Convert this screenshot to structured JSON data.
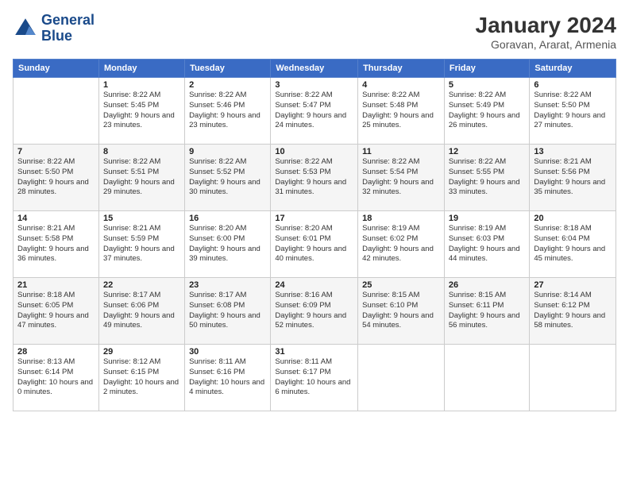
{
  "logo": {
    "line1": "General",
    "line2": "Blue"
  },
  "title": "January 2024",
  "subtitle": "Goravan, Ararat, Armenia",
  "weekdays": [
    "Sunday",
    "Monday",
    "Tuesday",
    "Wednesday",
    "Thursday",
    "Friday",
    "Saturday"
  ],
  "weeks": [
    [
      {
        "day": "",
        "sunrise": "",
        "sunset": "",
        "daylight": ""
      },
      {
        "day": "1",
        "sunrise": "Sunrise: 8:22 AM",
        "sunset": "Sunset: 5:45 PM",
        "daylight": "Daylight: 9 hours and 23 minutes."
      },
      {
        "day": "2",
        "sunrise": "Sunrise: 8:22 AM",
        "sunset": "Sunset: 5:46 PM",
        "daylight": "Daylight: 9 hours and 23 minutes."
      },
      {
        "day": "3",
        "sunrise": "Sunrise: 8:22 AM",
        "sunset": "Sunset: 5:47 PM",
        "daylight": "Daylight: 9 hours and 24 minutes."
      },
      {
        "day": "4",
        "sunrise": "Sunrise: 8:22 AM",
        "sunset": "Sunset: 5:48 PM",
        "daylight": "Daylight: 9 hours and 25 minutes."
      },
      {
        "day": "5",
        "sunrise": "Sunrise: 8:22 AM",
        "sunset": "Sunset: 5:49 PM",
        "daylight": "Daylight: 9 hours and 26 minutes."
      },
      {
        "day": "6",
        "sunrise": "Sunrise: 8:22 AM",
        "sunset": "Sunset: 5:50 PM",
        "daylight": "Daylight: 9 hours and 27 minutes."
      }
    ],
    [
      {
        "day": "7",
        "sunrise": "Sunrise: 8:22 AM",
        "sunset": "Sunset: 5:50 PM",
        "daylight": "Daylight: 9 hours and 28 minutes."
      },
      {
        "day": "8",
        "sunrise": "Sunrise: 8:22 AM",
        "sunset": "Sunset: 5:51 PM",
        "daylight": "Daylight: 9 hours and 29 minutes."
      },
      {
        "day": "9",
        "sunrise": "Sunrise: 8:22 AM",
        "sunset": "Sunset: 5:52 PM",
        "daylight": "Daylight: 9 hours and 30 minutes."
      },
      {
        "day": "10",
        "sunrise": "Sunrise: 8:22 AM",
        "sunset": "Sunset: 5:53 PM",
        "daylight": "Daylight: 9 hours and 31 minutes."
      },
      {
        "day": "11",
        "sunrise": "Sunrise: 8:22 AM",
        "sunset": "Sunset: 5:54 PM",
        "daylight": "Daylight: 9 hours and 32 minutes."
      },
      {
        "day": "12",
        "sunrise": "Sunrise: 8:22 AM",
        "sunset": "Sunset: 5:55 PM",
        "daylight": "Daylight: 9 hours and 33 minutes."
      },
      {
        "day": "13",
        "sunrise": "Sunrise: 8:21 AM",
        "sunset": "Sunset: 5:56 PM",
        "daylight": "Daylight: 9 hours and 35 minutes."
      }
    ],
    [
      {
        "day": "14",
        "sunrise": "Sunrise: 8:21 AM",
        "sunset": "Sunset: 5:58 PM",
        "daylight": "Daylight: 9 hours and 36 minutes."
      },
      {
        "day": "15",
        "sunrise": "Sunrise: 8:21 AM",
        "sunset": "Sunset: 5:59 PM",
        "daylight": "Daylight: 9 hours and 37 minutes."
      },
      {
        "day": "16",
        "sunrise": "Sunrise: 8:20 AM",
        "sunset": "Sunset: 6:00 PM",
        "daylight": "Daylight: 9 hours and 39 minutes."
      },
      {
        "day": "17",
        "sunrise": "Sunrise: 8:20 AM",
        "sunset": "Sunset: 6:01 PM",
        "daylight": "Daylight: 9 hours and 40 minutes."
      },
      {
        "day": "18",
        "sunrise": "Sunrise: 8:19 AM",
        "sunset": "Sunset: 6:02 PM",
        "daylight": "Daylight: 9 hours and 42 minutes."
      },
      {
        "day": "19",
        "sunrise": "Sunrise: 8:19 AM",
        "sunset": "Sunset: 6:03 PM",
        "daylight": "Daylight: 9 hours and 44 minutes."
      },
      {
        "day": "20",
        "sunrise": "Sunrise: 8:18 AM",
        "sunset": "Sunset: 6:04 PM",
        "daylight": "Daylight: 9 hours and 45 minutes."
      }
    ],
    [
      {
        "day": "21",
        "sunrise": "Sunrise: 8:18 AM",
        "sunset": "Sunset: 6:05 PM",
        "daylight": "Daylight: 9 hours and 47 minutes."
      },
      {
        "day": "22",
        "sunrise": "Sunrise: 8:17 AM",
        "sunset": "Sunset: 6:06 PM",
        "daylight": "Daylight: 9 hours and 49 minutes."
      },
      {
        "day": "23",
        "sunrise": "Sunrise: 8:17 AM",
        "sunset": "Sunset: 6:08 PM",
        "daylight": "Daylight: 9 hours and 50 minutes."
      },
      {
        "day": "24",
        "sunrise": "Sunrise: 8:16 AM",
        "sunset": "Sunset: 6:09 PM",
        "daylight": "Daylight: 9 hours and 52 minutes."
      },
      {
        "day": "25",
        "sunrise": "Sunrise: 8:15 AM",
        "sunset": "Sunset: 6:10 PM",
        "daylight": "Daylight: 9 hours and 54 minutes."
      },
      {
        "day": "26",
        "sunrise": "Sunrise: 8:15 AM",
        "sunset": "Sunset: 6:11 PM",
        "daylight": "Daylight: 9 hours and 56 minutes."
      },
      {
        "day": "27",
        "sunrise": "Sunrise: 8:14 AM",
        "sunset": "Sunset: 6:12 PM",
        "daylight": "Daylight: 9 hours and 58 minutes."
      }
    ],
    [
      {
        "day": "28",
        "sunrise": "Sunrise: 8:13 AM",
        "sunset": "Sunset: 6:14 PM",
        "daylight": "Daylight: 10 hours and 0 minutes."
      },
      {
        "day": "29",
        "sunrise": "Sunrise: 8:12 AM",
        "sunset": "Sunset: 6:15 PM",
        "daylight": "Daylight: 10 hours and 2 minutes."
      },
      {
        "day": "30",
        "sunrise": "Sunrise: 8:11 AM",
        "sunset": "Sunset: 6:16 PM",
        "daylight": "Daylight: 10 hours and 4 minutes."
      },
      {
        "day": "31",
        "sunrise": "Sunrise: 8:11 AM",
        "sunset": "Sunset: 6:17 PM",
        "daylight": "Daylight: 10 hours and 6 minutes."
      },
      {
        "day": "",
        "sunrise": "",
        "sunset": "",
        "daylight": ""
      },
      {
        "day": "",
        "sunrise": "",
        "sunset": "",
        "daylight": ""
      },
      {
        "day": "",
        "sunrise": "",
        "sunset": "",
        "daylight": ""
      }
    ]
  ]
}
